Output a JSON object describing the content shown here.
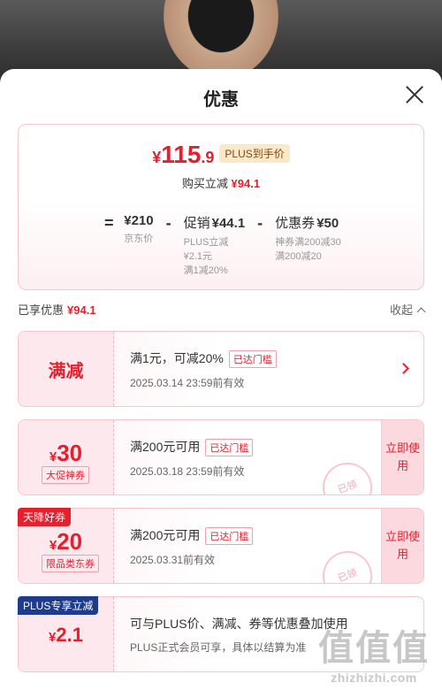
{
  "header": {
    "title": "优惠"
  },
  "summary": {
    "currency": "¥",
    "price_int": "115",
    "price_dec": ".9",
    "plus_tag": "PLUS到手价",
    "buy_label": "购买立减",
    "buy_amount": "¥94.1",
    "formula": {
      "eq": "=",
      "base_amount": "¥210",
      "base_label": "京东价",
      "minus": "-",
      "promo_label": "促销",
      "promo_amount": "¥44.1",
      "promo_sub1": "PLUS立减",
      "promo_sub2": "¥2.1元",
      "promo_sub3": "满1减20%",
      "coupon_label": "优惠券",
      "coupon_amount": "¥50",
      "coupon_sub1": "神券满200减30",
      "coupon_sub2": "满200减20"
    }
  },
  "enjoyed": {
    "label": "已享优惠",
    "amount": "¥94.1",
    "collapse": "收起"
  },
  "cards": [
    {
      "left_text": "满减",
      "line1": "满1元，可减20%",
      "badge": "已达门槛",
      "line2": "2025.03.14 23:59前有效"
    },
    {
      "currency": "¥",
      "value": "30",
      "sub": "大促神券",
      "line1": "满200元可用",
      "badge": "已达门槛",
      "line2": "2025.03.18 23:59前有效",
      "button": "立即使用",
      "stamp": "已领"
    },
    {
      "corner": "天降好券",
      "currency": "¥",
      "value": "20",
      "sub": "限品类东券",
      "line1": "满200元可用",
      "badge": "已达门槛",
      "line2": "2025.03.31前有效",
      "button": "立即使用",
      "stamp": "已领"
    },
    {
      "corner": "PLUS专享立减",
      "currency": "¥",
      "value": "2.1",
      "line1": "可与PLUS价、满减、券等优惠叠加使用",
      "line2": "PLUS正式会员可享，具体以结算为准"
    }
  ],
  "watermark": {
    "glyphs": "值值值",
    "text": "zhizhizhi.com"
  },
  "colors": {
    "accent": "#e5202e",
    "plus_tag_bg": "#fbe8c8",
    "corner_blue": "#1f3c8c"
  }
}
